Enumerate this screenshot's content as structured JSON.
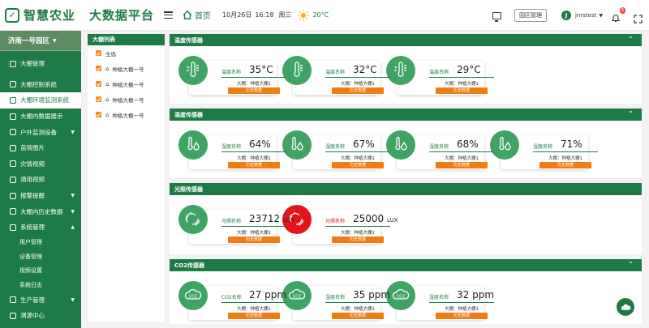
{
  "header": {
    "logo_text": "智慧农业",
    "platform_title": "大数据平台",
    "home_label": "首页",
    "date": "10月26日",
    "time": "16:18",
    "weekday": "周三",
    "temperature": "20°C",
    "park_manage_label": "园区管理",
    "user_initial": "J",
    "username": "jnrstest",
    "notification_count": "6",
    "icons": [
      "menu-icon",
      "home-icon",
      "sun-icon",
      "monitor-icon",
      "bell-icon",
      "fullscreen-icon"
    ]
  },
  "sidebar": {
    "park_name": "济南一号园区",
    "items": [
      {
        "label": "大棚管理"
      },
      {
        "label": "大棚控制系统"
      },
      {
        "label": "大棚环境监测系统"
      },
      {
        "label": "大棚内数据展示"
      },
      {
        "label": "户外监测设备"
      },
      {
        "label": "苗情图片"
      },
      {
        "label": "灾情视频"
      },
      {
        "label": "通用视频"
      },
      {
        "label": "报警提醒"
      },
      {
        "label": "大棚内历史数据"
      },
      {
        "label": "系统管理"
      }
    ],
    "sub_items": [
      {
        "label": "用户管理"
      },
      {
        "label": "设备管理"
      },
      {
        "label": "视频设置"
      },
      {
        "label": "系统日志"
      }
    ],
    "bottom_items": [
      {
        "label": "生产管理"
      },
      {
        "label": "溯源中心"
      }
    ]
  },
  "greenhouse_list": {
    "title": "大棚列表",
    "select_all": "全选",
    "items": [
      {
        "label": "种植大棚一号"
      },
      {
        "label": "种植大棚一号"
      },
      {
        "label": "种植大棚一号"
      },
      {
        "label": "种植大棚一号"
      }
    ]
  },
  "sections": [
    {
      "title": "温度传感器",
      "cards": [
        {
          "name": "温度名称",
          "value": "35°C",
          "greenhouse": "大棚：种植大棚1",
          "button": "历史数据"
        },
        {
          "name": "温度名称",
          "value": "32°C",
          "greenhouse": "大棚：种植大棚1",
          "button": "历史数据"
        },
        {
          "name": "温度名称",
          "value": "29°C",
          "greenhouse": "大棚：种植大棚1",
          "button": "历史数据"
        }
      ]
    },
    {
      "title": "湿度传感器",
      "cards": [
        {
          "name": "湿度名称",
          "value": "64%",
          "greenhouse": "大棚：种植大棚1",
          "button": "历史数据"
        },
        {
          "name": "湿度名称",
          "value": "67%",
          "greenhouse": "大棚：种植大棚1",
          "button": "历史数据"
        },
        {
          "name": "湿度名称",
          "value": "68%",
          "greenhouse": "大棚：种植大棚1",
          "button": "历史数据"
        },
        {
          "name": "湿度名称",
          "value": "71%",
          "greenhouse": "大棚：种植大棚1",
          "button": "历史数据"
        }
      ]
    },
    {
      "title": "光照传感器",
      "cards": [
        {
          "name": "光照名称",
          "value": "23712",
          "unit": "LUX",
          "greenhouse": "大棚：种植大棚1",
          "button": "历史数据"
        },
        {
          "name": "光照名称",
          "value": "25000",
          "unit": "LUX",
          "greenhouse": "大棚：种植大棚1",
          "button": "历史数据"
        }
      ]
    },
    {
      "title": "CO2传感器",
      "cards": [
        {
          "name": "CO2名称",
          "value": "27 ppm",
          "greenhouse": "大棚：种植大棚1",
          "button": "历史数据"
        },
        {
          "name": "湿度名称",
          "value": "35 ppm",
          "greenhouse": "大棚：种植大棚1",
          "button": "历史数据"
        },
        {
          "name": "湿度名称",
          "value": "32 ppm",
          "greenhouse": "大棚：种植大棚1",
          "button": "历史数据"
        }
      ]
    }
  ],
  "colors": {
    "primary": "#1e7b45",
    "accent": "#f07c12",
    "icon_green": "#3fa463",
    "alert_red": "#e2141c"
  }
}
